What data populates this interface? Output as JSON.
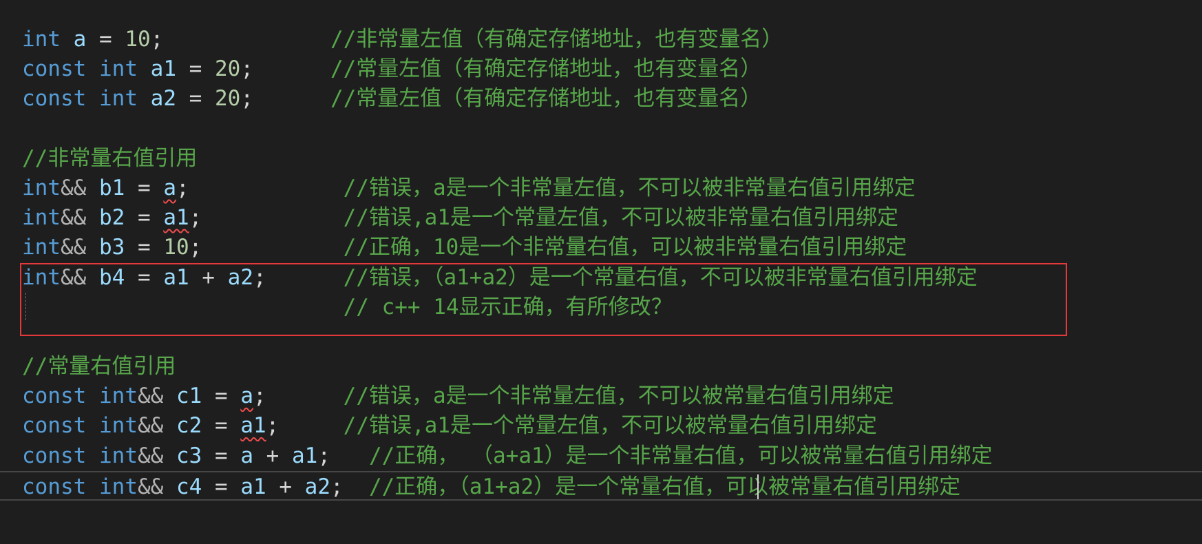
{
  "colors": {
    "background": "#1e1e1e",
    "keyword": "#569cd6",
    "identifier": "#9cdcfe",
    "number": "#b5cea8",
    "comment": "#57a64a",
    "annotation_box": "#e5383b"
  },
  "lines": [
    [
      {
        "t": "int",
        "c": "kw"
      },
      {
        "t": " "
      },
      {
        "t": "a",
        "c": "id"
      },
      {
        "t": " = ",
        "c": "op"
      },
      {
        "t": "10",
        "c": "num"
      },
      {
        "t": ";",
        "c": "op"
      },
      {
        "t": "             "
      },
      {
        "t": "//非常量左值（有确定存储地址，也有变量名）",
        "c": "cm"
      }
    ],
    [
      {
        "t": "const",
        "c": "kw"
      },
      {
        "t": " "
      },
      {
        "t": "int",
        "c": "kw"
      },
      {
        "t": " "
      },
      {
        "t": "a1",
        "c": "id"
      },
      {
        "t": " = ",
        "c": "op"
      },
      {
        "t": "20",
        "c": "num"
      },
      {
        "t": ";",
        "c": "op"
      },
      {
        "t": "      "
      },
      {
        "t": "//常量左值（有确定存储地址，也有变量名）",
        "c": "cm"
      }
    ],
    [
      {
        "t": "const",
        "c": "kw"
      },
      {
        "t": " "
      },
      {
        "t": "int",
        "c": "kw"
      },
      {
        "t": " "
      },
      {
        "t": "a2",
        "c": "id"
      },
      {
        "t": " = ",
        "c": "op"
      },
      {
        "t": "20",
        "c": "num"
      },
      {
        "t": ";",
        "c": "op"
      },
      {
        "t": "      "
      },
      {
        "t": "//常量左值（有确定存储地址，也有变量名）",
        "c": "cm"
      }
    ],
    [],
    [
      {
        "t": "//非常量右值引用",
        "c": "cm"
      }
    ],
    [
      {
        "t": "int",
        "c": "kw"
      },
      {
        "t": "&&",
        "c": "amp"
      },
      {
        "t": " "
      },
      {
        "t": "b1",
        "c": "id"
      },
      {
        "t": " = ",
        "c": "op"
      },
      {
        "t": "a",
        "c": "id",
        "err": true
      },
      {
        "t": ";",
        "c": "op"
      },
      {
        "t": "            "
      },
      {
        "t": "//错误，a是一个非常量左值，不可以被非常量右值引用绑定",
        "c": "cm"
      }
    ],
    [
      {
        "t": "int",
        "c": "kw"
      },
      {
        "t": "&&",
        "c": "amp"
      },
      {
        "t": " "
      },
      {
        "t": "b2",
        "c": "id"
      },
      {
        "t": " = ",
        "c": "op"
      },
      {
        "t": "a1",
        "c": "id",
        "err": true
      },
      {
        "t": ";",
        "c": "op"
      },
      {
        "t": "           "
      },
      {
        "t": "//错误,a1是一个常量左值，不可以被非常量右值引用绑定",
        "c": "cm"
      }
    ],
    [
      {
        "t": "int",
        "c": "kw"
      },
      {
        "t": "&&",
        "c": "amp"
      },
      {
        "t": " "
      },
      {
        "t": "b3",
        "c": "id"
      },
      {
        "t": " = ",
        "c": "op"
      },
      {
        "t": "10",
        "c": "num"
      },
      {
        "t": ";",
        "c": "op"
      },
      {
        "t": "           "
      },
      {
        "t": "//正确，10是一个非常量右值，可以被非常量右值引用绑定",
        "c": "cm"
      }
    ],
    [
      {
        "t": "int",
        "c": "kw"
      },
      {
        "t": "&&",
        "c": "amp"
      },
      {
        "t": " "
      },
      {
        "t": "b4",
        "c": "id"
      },
      {
        "t": " = ",
        "c": "op"
      },
      {
        "t": "a1",
        "c": "id"
      },
      {
        "t": " + ",
        "c": "op"
      },
      {
        "t": "a2",
        "c": "id"
      },
      {
        "t": ";",
        "c": "op"
      },
      {
        "t": "      "
      },
      {
        "t": "//错误，（a1+a2）是一个常量右值，不可以被非常量右值引用绑定",
        "c": "cm"
      }
    ],
    [
      {
        "t": "                         "
      },
      {
        "t": "// c++ 14显示正确，有所修改？",
        "c": "cm"
      }
    ],
    [],
    [
      {
        "t": "//常量右值引用",
        "c": "cm"
      }
    ],
    [
      {
        "t": "const",
        "c": "kw"
      },
      {
        "t": " "
      },
      {
        "t": "int",
        "c": "kw"
      },
      {
        "t": "&&",
        "c": "amp"
      },
      {
        "t": " "
      },
      {
        "t": "c1",
        "c": "id"
      },
      {
        "t": " = ",
        "c": "op"
      },
      {
        "t": "a",
        "c": "id",
        "err": true
      },
      {
        "t": ";",
        "c": "op"
      },
      {
        "t": "      "
      },
      {
        "t": "//错误，a是一个非常量左值，不可以被常量右值引用绑定",
        "c": "cm"
      }
    ],
    [
      {
        "t": "const",
        "c": "kw"
      },
      {
        "t": " "
      },
      {
        "t": "int",
        "c": "kw"
      },
      {
        "t": "&&",
        "c": "amp"
      },
      {
        "t": " "
      },
      {
        "t": "c2",
        "c": "id"
      },
      {
        "t": " = ",
        "c": "op"
      },
      {
        "t": "a1",
        "c": "id",
        "err": true
      },
      {
        "t": ";",
        "c": "op"
      },
      {
        "t": "     "
      },
      {
        "t": "//错误,a1是一个常量左值，不可以被常量右值引用绑定",
        "c": "cm"
      }
    ],
    [
      {
        "t": "const",
        "c": "kw"
      },
      {
        "t": " "
      },
      {
        "t": "int",
        "c": "kw"
      },
      {
        "t": "&&",
        "c": "amp"
      },
      {
        "t": " "
      },
      {
        "t": "c3",
        "c": "id"
      },
      {
        "t": " = ",
        "c": "op"
      },
      {
        "t": "a",
        "c": "id"
      },
      {
        "t": " + ",
        "c": "op"
      },
      {
        "t": "a1",
        "c": "id"
      },
      {
        "t": ";",
        "c": "op"
      },
      {
        "t": "   "
      },
      {
        "t": "//正确， （a+a1）是一个非常量右值，可以被常量右值引用绑定",
        "c": "cm"
      }
    ],
    [
      {
        "t": "const",
        "c": "kw"
      },
      {
        "t": " "
      },
      {
        "t": "int",
        "c": "kw"
      },
      {
        "t": "&&",
        "c": "amp"
      },
      {
        "t": " "
      },
      {
        "t": "c4",
        "c": "id"
      },
      {
        "t": " = ",
        "c": "op"
      },
      {
        "t": "a1",
        "c": "id"
      },
      {
        "t": " + ",
        "c": "op"
      },
      {
        "t": "a2",
        "c": "id"
      },
      {
        "t": ";",
        "c": "op"
      },
      {
        "t": "  "
      },
      {
        "t": "//正确，（a1+a2）是一个常量右值，可以被常量右值引用绑定",
        "c": "cm"
      }
    ]
  ],
  "current_line": 16
}
